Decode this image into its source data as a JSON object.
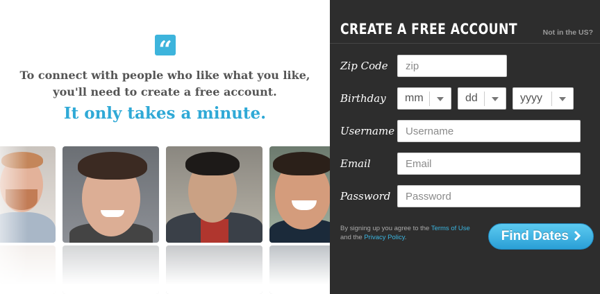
{
  "intro": {
    "quote_glyph": "“",
    "line1": "To connect with people who like what you like,",
    "line2": "you'll need to create a free account.",
    "tagline": "It only takes a minute.",
    "accent_color": "#2fa9d6"
  },
  "form": {
    "title": "CREATE A FREE ACCOUNT",
    "not_in_us": "Not in the US?",
    "zip": {
      "label": "Zip Code",
      "placeholder": "zip"
    },
    "birthday": {
      "label": "Birthday",
      "month": "mm",
      "day": "dd",
      "year": "yyyy"
    },
    "username": {
      "label": "Username",
      "placeholder": "Username"
    },
    "email": {
      "label": "Email",
      "placeholder": "Email"
    },
    "password": {
      "label": "Password",
      "placeholder": "Password"
    },
    "legal_prefix": "By signing up you agree to the ",
    "terms_link": "Terms of Use",
    "legal_mid": " and the ",
    "privacy_link": "Privacy Policy",
    "legal_suffix": ".",
    "submit": "Find Dates",
    "submit_icon": "chevron-right-icon"
  }
}
